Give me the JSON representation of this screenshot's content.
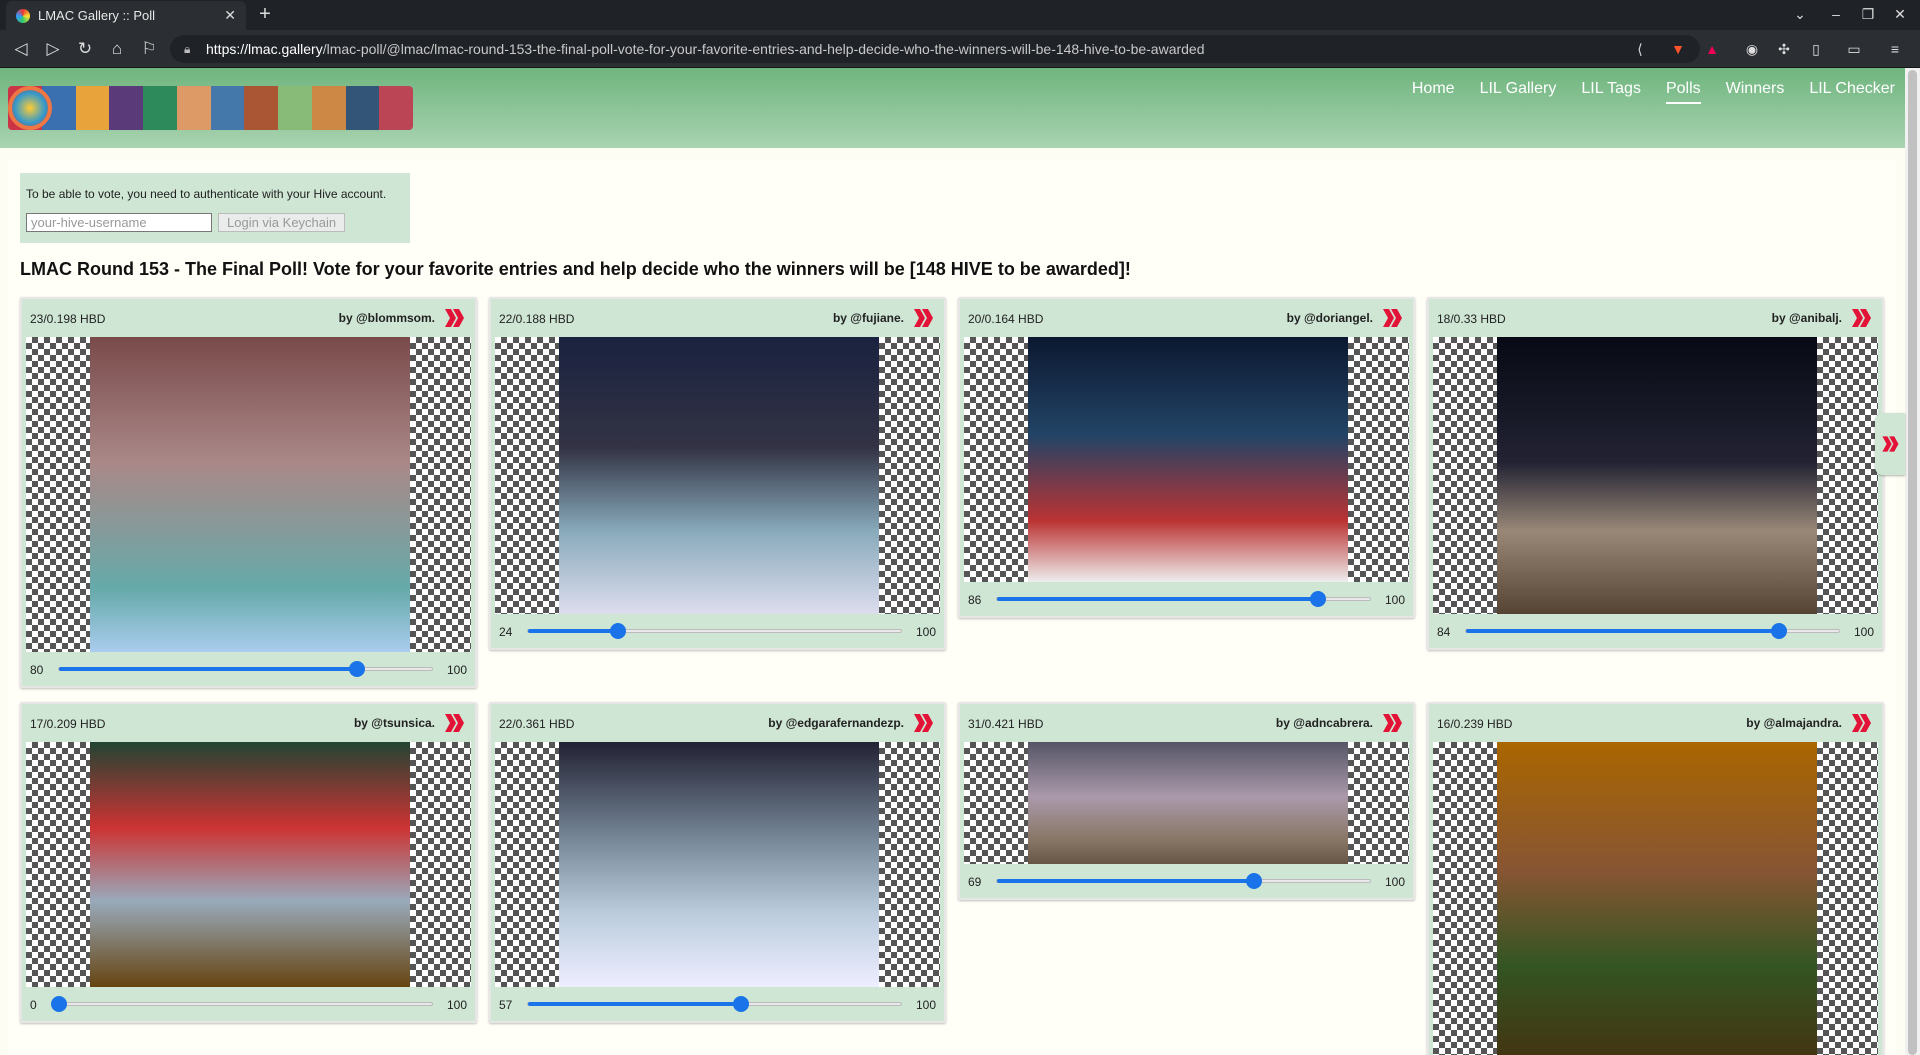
{
  "browser": {
    "tab_title": "LMAC Gallery :: Poll",
    "url_host": "https://lmac.gallery",
    "url_path": "/lmac-poll/@lmac/lmac-round-153-the-final-poll-vote-for-your-favorite-entries-and-help-decide-who-the-winners-will-be-148-hive-to-be-awarded"
  },
  "nav": {
    "items": [
      "Home",
      "LIL Gallery",
      "LIL Tags",
      "Polls",
      "Winners",
      "LIL Checker"
    ],
    "active": "Polls"
  },
  "login": {
    "text": "To be able to vote, you need to authenticate with your Hive account.",
    "placeholder": "your-hive-username",
    "button": "Login via Keychain"
  },
  "poll_title": "LMAC Round 153 - The Final Poll! Vote for your favorite entries and help decide who the winners will be [148 HIVE to be awarded]!",
  "slider_max_label": "100",
  "colors": {
    "slider": "#1a73e8",
    "card": "#cfe6d4",
    "hive_red": "#e31337",
    "header_green": "#6fb57e"
  },
  "entries": [
    {
      "hbd": "23/0.198 HBD",
      "author": "by @blommsom.",
      "value": 80,
      "icon": "hive-icon"
    },
    {
      "hbd": "22/0.188 HBD",
      "author": "by @fujiane.",
      "value": 24,
      "icon": "hive-icon"
    },
    {
      "hbd": "20/0.164 HBD",
      "author": "by @doriangel.",
      "value": 86,
      "icon": "hive-icon"
    },
    {
      "hbd": "18/0.33 HBD",
      "author": "by @anibalj.",
      "value": 84,
      "icon": "hive-icon"
    },
    {
      "hbd": "17/0.209 HBD",
      "author": "by @tsunsica.",
      "value": 0,
      "icon": "hive-icon"
    },
    {
      "hbd": "22/0.361 HBD",
      "author": "by @edgarafernandezp.",
      "value": 57,
      "icon": "hive-icon"
    },
    {
      "hbd": "31/0.421 HBD",
      "author": "by @adncabrera.",
      "value": 69,
      "icon": "hive-icon"
    },
    {
      "hbd": "16/0.239 HBD",
      "author": "by @almajandra.",
      "value": null,
      "icon": "hive-icon"
    }
  ]
}
